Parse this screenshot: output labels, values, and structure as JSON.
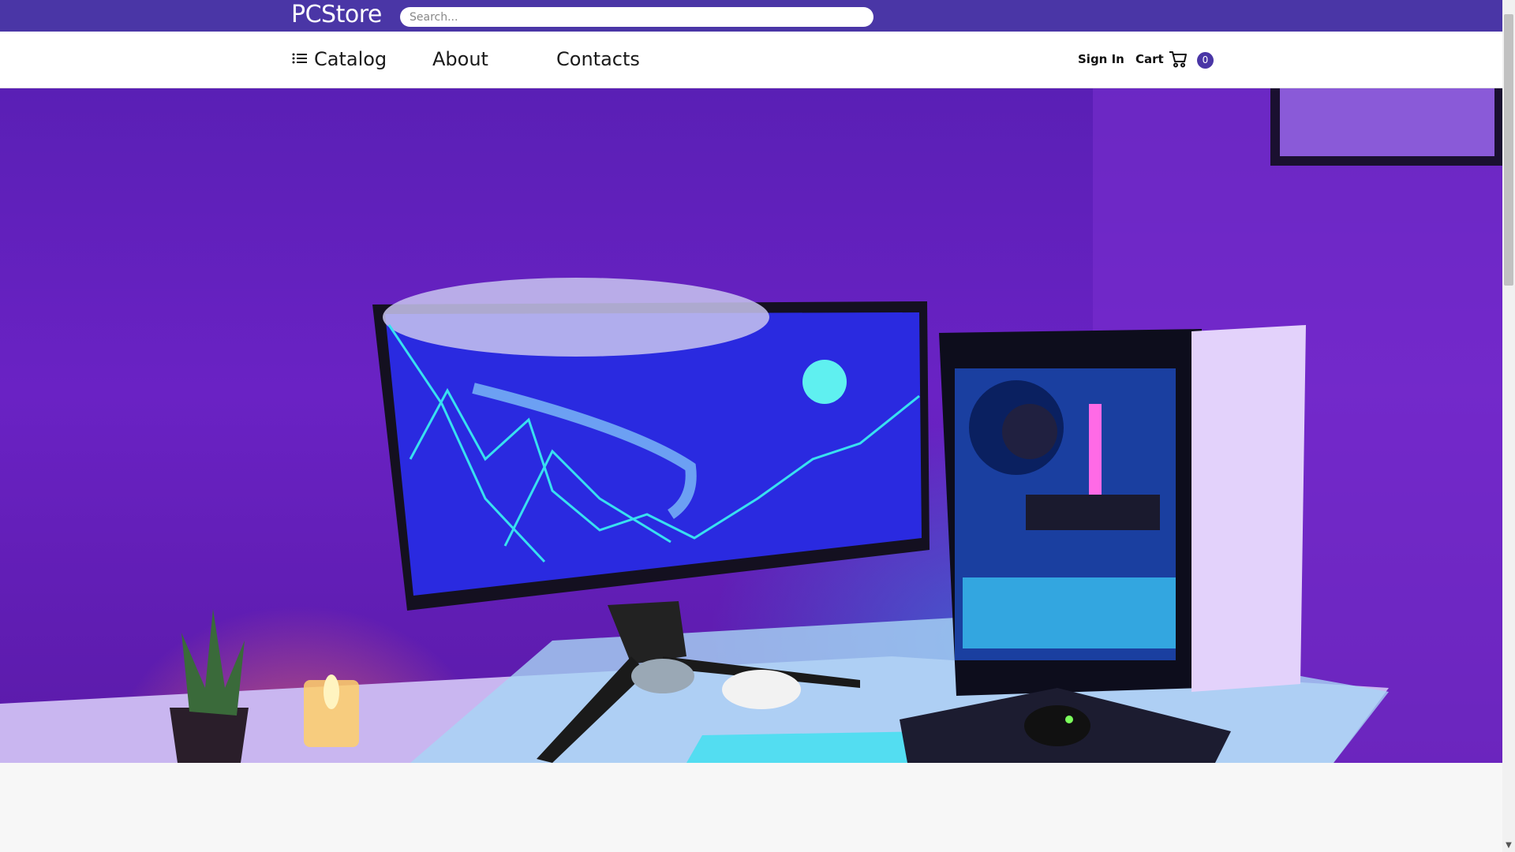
{
  "brand": {
    "name": "PCStore",
    "color": "#4a36a6"
  },
  "search": {
    "placeholder": "Search...",
    "value": ""
  },
  "nav": {
    "catalog_label": "Catalog",
    "catalog_icon": "list-icon",
    "about_label": "About",
    "contacts_label": "Contacts"
  },
  "account": {
    "signin_label": "Sign In"
  },
  "cart": {
    "label": "Cart",
    "icon": "cart-icon",
    "count": "0"
  },
  "hero": {
    "image": "gaming-desk-setup-photo"
  }
}
